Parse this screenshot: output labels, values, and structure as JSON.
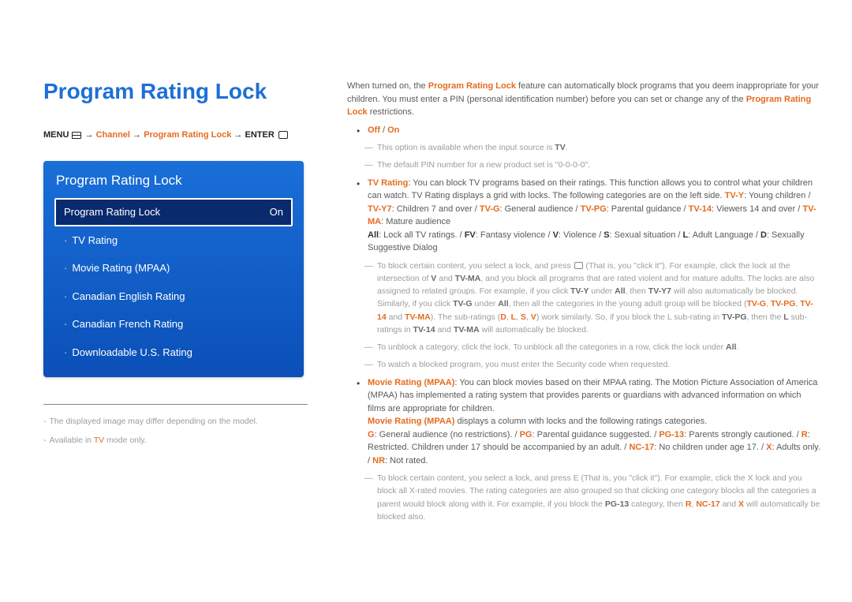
{
  "title": "Program Rating Lock",
  "breadcrumb": {
    "menu": "MENU",
    "channel": "Channel",
    "prl": "Program Rating Lock",
    "enter": "ENTER"
  },
  "panel": {
    "title": "Program Rating Lock",
    "selected": {
      "label": "Program Rating Lock",
      "value": "On"
    },
    "items": [
      "TV Rating",
      "Movie Rating (MPAA)",
      "Canadian English Rating",
      "Canadian French Rating",
      "Downloadable U.S. Rating"
    ]
  },
  "footnotes": {
    "line1": "The displayed image may differ depending on the model.",
    "line2_pre": "Available in ",
    "line2_tv": "TV",
    "line2_post": " mode only."
  },
  "intro": {
    "p1_pre": "When turned on, the ",
    "p1_b1": "Program Rating Lock",
    "p1_mid": " feature can automatically block programs that you deem inappropriate for your children. You must enter a PIN (personal identification number) before you can set or change any of the ",
    "p1_b2": "Program Rating Lock",
    "p1_post": " restrictions."
  },
  "offon": {
    "off": "Off",
    "slash": " / ",
    "on": "On"
  },
  "note1": {
    "pre": "This option is available when the input source is ",
    "tv": "TV",
    "post": "."
  },
  "note2": "The default PIN number for a new product set is \"0-0-0-0\".",
  "tvRating": {
    "b": "TV Rating",
    "t1": ": You can block TV programs based on their ratings. This function allows you to control what your children can watch. TV Rating displays a grid with locks. The following categories are on the left side. ",
    "c1": "TV-Y",
    "d1": ": Young children / ",
    "c2": "TV-Y7",
    "d2": ": Children 7 and over / ",
    "c3": "TV-G",
    "d3": ": General audience / ",
    "c4": "TV-PG",
    "d4": ": Parental guidance / ",
    "c5": "TV-14",
    "d5": ": Viewers 14 and over / ",
    "c6": "TV-MA",
    "d6": ": Mature audience",
    "r1": "All",
    "rd1": ": Lock all TV ratings. / ",
    "r2": "FV",
    "rd2": ": Fantasy violence / ",
    "r3": "V",
    "rd3": ": Violence / ",
    "r4": "S",
    "rd4": ": Sexual situation / ",
    "r5": "L",
    "rd5": ": Adult Language / ",
    "r6": "D",
    "rd6": ": Sexually Suggestive Dialog"
  },
  "tvNote1": {
    "t1": "To block certain content, you select a lock, and press ",
    "t2": " (That is, you \"click it\"). For example, click the lock at the intersection of ",
    "v": "V",
    "and": " and ",
    "tvma": "TV-MA",
    "t3": ", and you block all programs that are rated violent and for mature adults. The locks are also assigned to related groups. For example, if you click ",
    "tvy": "TV-Y",
    "under": " under ",
    "all": "All",
    "then": ", then ",
    "tvy7": "TV-Y7",
    "t4": " will also automatically be blocked. Similarly, if you click ",
    "tvg": "TV-G",
    "t5": ", then all the categories in the young adult group will be blocked (",
    "tvg2": "TV-G",
    "c": ", ",
    "tvpg": "TV-PG",
    "tv14": "TV-14",
    "a2": " and ",
    "tvma2": "TV-MA",
    "t6": "). The sub-ratings (",
    "d": "D",
    "l": "L",
    "s": "S",
    "v2": "V",
    "t7": ") work similarly. So, if you block the L sub-rating in ",
    "tvpg2": "TV-PG",
    "t8": ", then the ",
    "l2": "L",
    "t9": " sub-ratings in ",
    "tv142": "TV-14",
    "tvma3": "TV-MA",
    "t10": " will automatically be blocked."
  },
  "tvNote2": {
    "t1": "To unblock a category, click the lock. To unblock all the categories in a row, click the lock under ",
    "all": "All",
    "t2": "."
  },
  "tvNote3": "To watch a blocked program, you must enter the Security code when requested.",
  "movie": {
    "b": "Movie Rating (MPAA)",
    "t1": ": You can block movies based on their MPAA rating. The Motion Picture Association of America (MPAA) has implemented a rating system that provides parents or guardians with advanced information on which films are appropriate for children.",
    "b2": "Movie Rating (MPAA)",
    "t2": " displays a column with locks and the following ratings categories.",
    "g": "G",
    "gd": ": General audience (no restrictions). / ",
    "pg": "PG",
    "pgd": ": Parental guidance suggested. / ",
    "pg13": "PG-13",
    "pg13d": ": Parents strongly cautioned. / ",
    "r": "R",
    "rd": ": Restricted. Children under 17 should be accompanied by an adult. / ",
    "nc17": "NC-17",
    "nc17d": ": No children under age 17. / ",
    "x": "X",
    "xd": ": Adults only. / ",
    "nr": "NR",
    "nrd": ": Not rated."
  },
  "movieNote": {
    "t1": "To block certain content, you select a lock, and press E (That is, you \"click it\"). For example, click the X lock and you block all X-rated movies. The rating categories are also grouped so that clicking one category blocks all the categories a parent would block along with it. For example, if you block the ",
    "pg13": "PG-13",
    "t2": " category, then ",
    "r": "R",
    "c": ", ",
    "nc17": "NC-17",
    "a": " and ",
    "x": "X",
    "t3": " will automatically be blocked also."
  }
}
